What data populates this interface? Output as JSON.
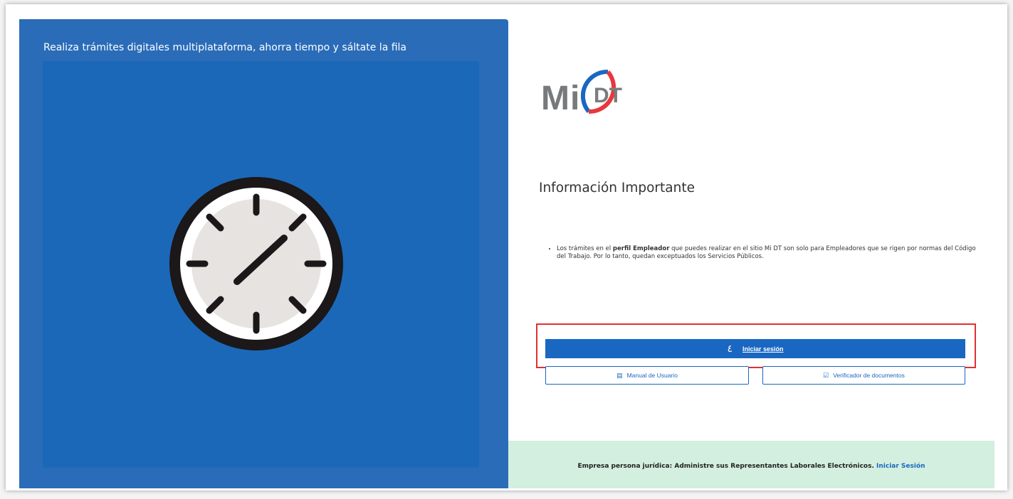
{
  "left": {
    "tagline": "Realiza trámites digitales multiplataforma, ahorra tiempo y sáltate la fila",
    "illustration_icon": "clock-icon"
  },
  "logo": {
    "mi": "Mi",
    "dt": "DT",
    "colors": {
      "blue": "#1a67c2",
      "red": "#e8383d",
      "gray": "#777a7d"
    }
  },
  "info": {
    "title": "Información Importante",
    "bullet": {
      "pre": "Los trámites en el ",
      "bold": "perfil Empleador",
      "post": " que puedes realizar en el sitio Mi DT son solo para Empleadores que se rigen por normas del Código del Trabajo. Por lo tanto, quedan exceptuados los Servicios Públicos."
    }
  },
  "buttons": {
    "login_label": "Iniciar sesión",
    "login_icon": "fingerprint-icon",
    "manual_label": "Manual de Usuario",
    "manual_icon": "book-icon",
    "verifier_label": "Verificador de documentos",
    "verifier_icon": "clipboard-check-icon"
  },
  "footer": {
    "text": "Empresa persona jurídica: Administre sus Representantes Laborales Electrónicos.",
    "link": "Iniciar Sesión"
  },
  "colors": {
    "panel_blue": "#2a6cb8",
    "primary": "#1a67c2",
    "footer_bg": "#d3efdf",
    "highlight": "#e03131"
  }
}
